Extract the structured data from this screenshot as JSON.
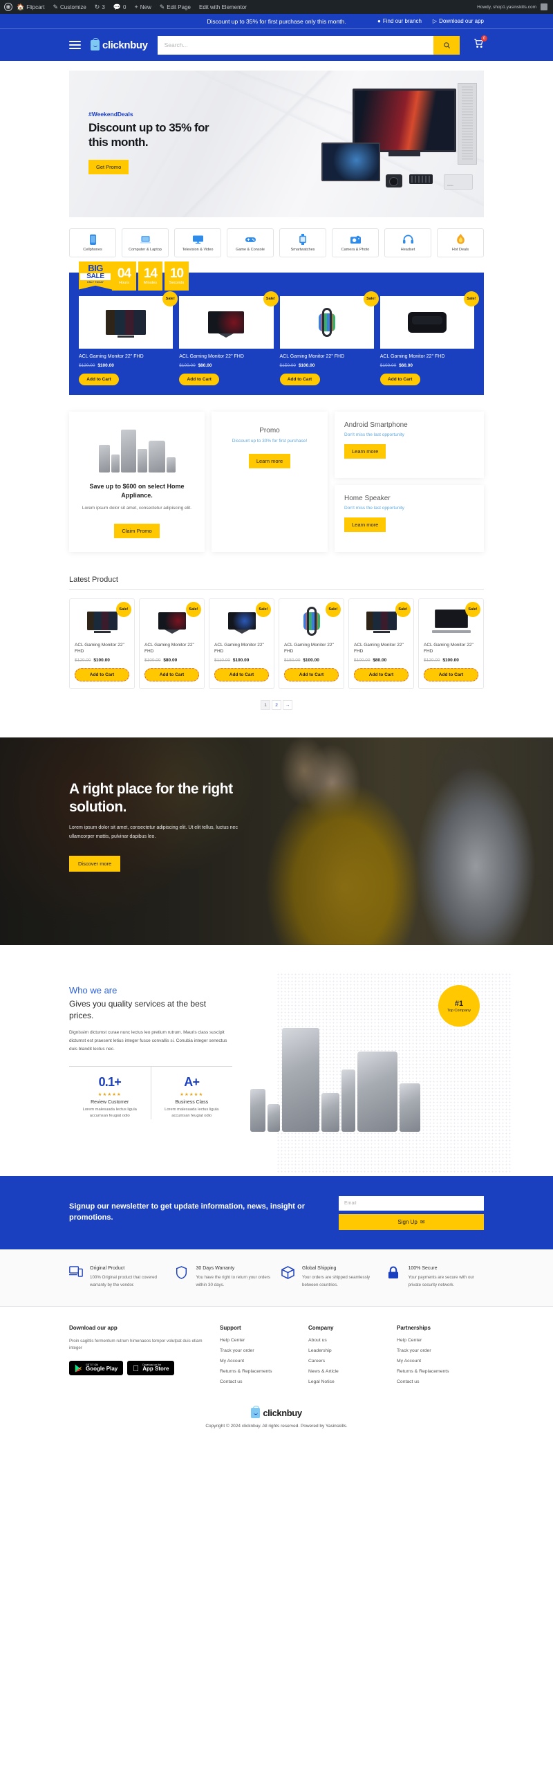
{
  "adminbar": {
    "logo_icon": "wordpress-icon",
    "items": [
      {
        "icon": "home-icon",
        "label": "Flipcart"
      },
      {
        "icon": "pencil-icon",
        "label": "Customize"
      },
      {
        "icon": "refresh-icon",
        "label": "3"
      },
      {
        "icon": "comment-icon",
        "label": "0"
      },
      {
        "icon": "plus-icon",
        "label": "New"
      },
      {
        "icon": "edit-icon",
        "label": "Edit Page"
      },
      {
        "icon": "elementor-icon",
        "label": "Edit with Elementor"
      }
    ],
    "howdy": "Howdy, shop1.yasinskills.com"
  },
  "announce": {
    "message": "Discount up to 35% for first purchase only this month.",
    "branch": "Find our branch",
    "app": "Download our app"
  },
  "nav": {
    "menu_icon": "hamburger-icon",
    "brand": "clicknbuy",
    "search_placeholder": "Search...",
    "search_icon": "search-icon",
    "cart_icon": "cart-icon",
    "cart_count": "0"
  },
  "hero": {
    "tag": "#WeekendDeals",
    "title": "Discount up to 35% for this month.",
    "cta": "Get Promo"
  },
  "categories": [
    {
      "label": "Cellphones",
      "icon": "phone-icon"
    },
    {
      "label": "Computer & Laptop",
      "icon": "laptop-icon"
    },
    {
      "label": "Television & Video",
      "icon": "tv-icon"
    },
    {
      "label": "Game & Console",
      "icon": "gamepad-icon"
    },
    {
      "label": "Smartwatches",
      "icon": "smartwatch-icon"
    },
    {
      "label": "Camera & Photo",
      "icon": "camera-icon"
    },
    {
      "label": "Headset",
      "icon": "headset-icon"
    },
    {
      "label": "Hot Deals",
      "icon": "fire-icon"
    }
  ],
  "bigsale": {
    "badge_line1": "BIG",
    "badge_line2": "SALE",
    "badge_line3": "ONLY TODAY",
    "timer": [
      {
        "value": "04",
        "unit": "Hours"
      },
      {
        "value": "14",
        "unit": "Minutes"
      },
      {
        "value": "10",
        "unit": "Seconds"
      }
    ],
    "badge_sale": "Sale!",
    "add_to_cart": "Add to Cart",
    "products": [
      {
        "name": "ACL Gaming Monitor 22\" FHD",
        "old": "$120.00",
        "new": "$100.00",
        "art": "tv"
      },
      {
        "name": "ACL Gaming Monitor 22\" FHD",
        "old": "$100.00",
        "new": "$80.00",
        "art": "gmon"
      },
      {
        "name": "ACL Gaming Monitor 22\" FHD",
        "old": "$150.00",
        "new": "$100.00",
        "art": "watch"
      },
      {
        "name": "ACL Gaming Monitor 22\" FHD",
        "old": "$100.00",
        "new": "$60.00",
        "art": "vr"
      }
    ]
  },
  "promos": {
    "appliance": {
      "title": "Save up to $600 on select Home Appliance.",
      "body": "Lorem ipsum dolor sit amet, consectetur adipiscing elit.",
      "cta": "Claim Promo"
    },
    "promo": {
      "title": "Promo",
      "body": "Discount up to 30% for first purchase!",
      "cta": "Learn more"
    },
    "android": {
      "title": "Android Smartphone",
      "body": "Don't miss the last opportunity",
      "cta": "Learn more"
    },
    "speaker": {
      "title": "Home Speaker",
      "body": "Don't miss the last opportunity",
      "cta": "Learn more"
    }
  },
  "latest": {
    "title": "Latest Product",
    "badge_sale": "Sale!",
    "add_to_cart": "Add to Cart",
    "products": [
      {
        "name": "ACL Gaming Monitor 22\" FHD",
        "old": "$120.00",
        "new": "$100.00",
        "art": "tv"
      },
      {
        "name": "ACL Gaming Monitor 22\" FHD",
        "old": "$100.00",
        "new": "$80.00",
        "art": "gmon"
      },
      {
        "name": "ACL Gaming Monitor 22\" FHD",
        "old": "$110.00",
        "new": "$100.00",
        "art": "gmon2"
      },
      {
        "name": "ACL Gaming Monitor 22\" FHD",
        "old": "$150.00",
        "new": "$100.00",
        "art": "watch"
      },
      {
        "name": "ACL Gaming Monitor 22\" FHD",
        "old": "$100.00",
        "new": "$80.00",
        "art": "tv"
      },
      {
        "name": "ACL Gaming Monitor 22\" FHD",
        "old": "$120.00",
        "new": "$100.00",
        "art": "laptop"
      }
    ],
    "pager": [
      "1",
      "2",
      "→"
    ]
  },
  "solution": {
    "title": "A right place for the right solution.",
    "body": "Lorem ipsum dolor sit amet, consectetur adipiscing elit. Ut elit tellus, luctus nec ullamcorper mattis, pulvinar dapibus leo.",
    "cta": "Discover more"
  },
  "who": {
    "eyebrow": "Who we are",
    "title": "Gives you quality services at the best prices.",
    "body": "Dignissim dictumst curae nunc lectus leo pretium rutrum. Mauris class suscipit dictumst est praesent letius integer fusce convallis si. Conubia integer senectus duis blandit lectus nec.",
    "badge_number": "#1",
    "badge_text": "Top Company",
    "stats": [
      {
        "value": "0.1+",
        "stars": "★★★★★",
        "label": "Review Customer",
        "sub": "Lorem malesuada lectus ligula accumsan feugiat odio"
      },
      {
        "value": "A+",
        "stars": "★★★★★",
        "label": "Business Class",
        "sub": "Lorem malesuada lectus ligula accumsan feugiat odio"
      }
    ]
  },
  "newsletter": {
    "title": "Signup our newsletter to get update information, news, insight or promotions.",
    "placeholder": "Email",
    "button": "Sign Up",
    "button_icon": "envelope-icon"
  },
  "features": [
    {
      "icon": "devices-icon",
      "title": "Original Product",
      "body": "100% Original product that covered warranty by the vendor."
    },
    {
      "icon": "shield-icon",
      "title": "30 Days Warranty",
      "body": "You have the right to return your orders within 30 days."
    },
    {
      "icon": "box-icon",
      "title": "Global Shipping",
      "body": "Your orders are shipped seamlessly between countries."
    },
    {
      "icon": "lock-icon",
      "title": "100% Secure",
      "body": "Your payments are secure with our private security network."
    }
  ],
  "footer": {
    "app_title": "Download our app",
    "app_body": "Proin sagittis fermentum rutrum himenaeos tempor volutpat duis etiam integer",
    "stores": [
      {
        "small": "GET IT ON",
        "big": "Google Play",
        "icon": "google-play-icon"
      },
      {
        "small": "Download on the",
        "big": "App Store",
        "icon": "apple-icon"
      }
    ],
    "columns": [
      {
        "title": "Support",
        "links": [
          "Help Center",
          "Track your order",
          "My Account",
          "Returns & Replacements",
          "Contact us"
        ]
      },
      {
        "title": "Company",
        "links": [
          "About us",
          "Leadership",
          "Careers",
          "News & Article",
          "Legal Notice"
        ]
      },
      {
        "title": "Partnerships",
        "links": [
          "Help Center",
          "Track your order",
          "My Account",
          "Returns & Replacements",
          "Contact us"
        ]
      }
    ],
    "brand": "clicknbuy",
    "copyright": "Copyright © 2024 clicknbuy. All rights reserved. Powered by Yasinskills."
  },
  "colors": {
    "brand_blue": "#1A3FBF",
    "accent_yellow": "#FFC800",
    "badge_red": "#E23B3B"
  }
}
